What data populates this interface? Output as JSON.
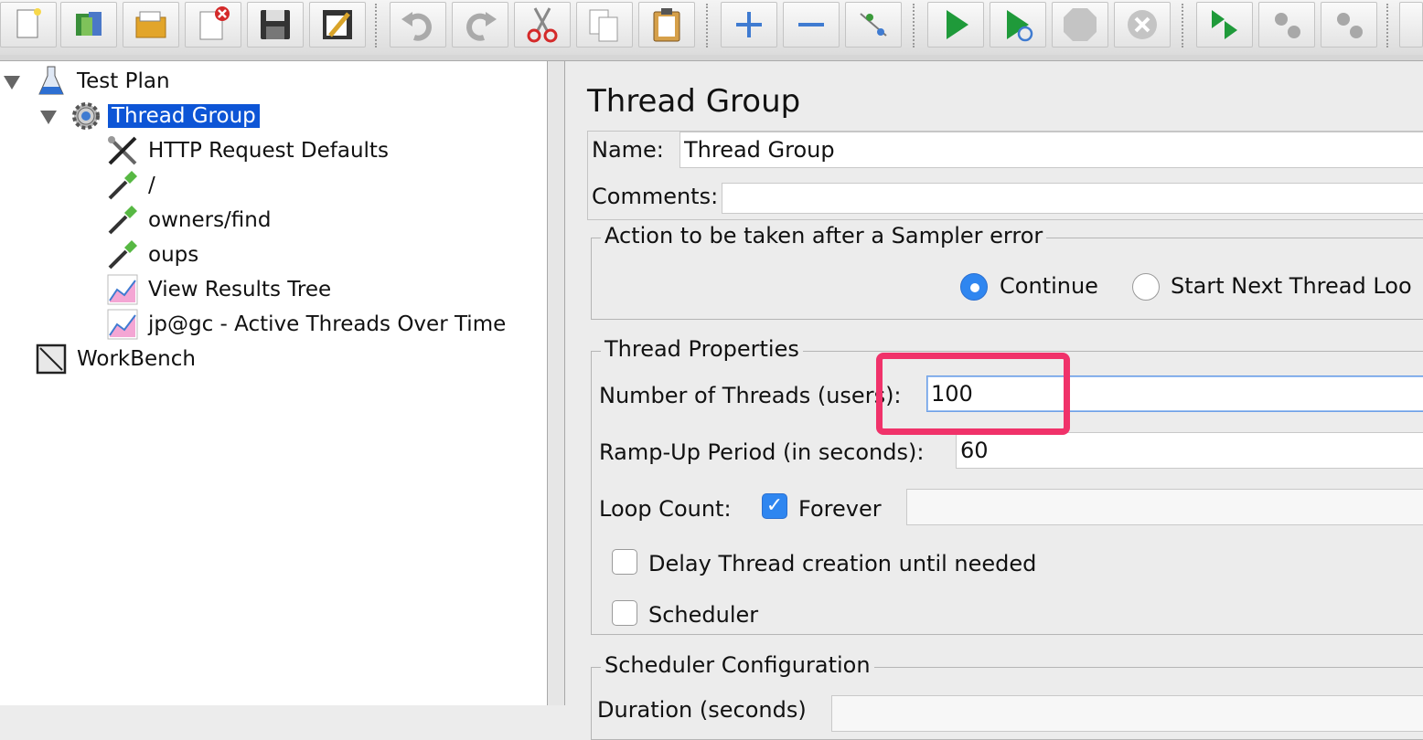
{
  "toolbar": {
    "buttons": [
      {
        "icon": "new-template-icon"
      },
      {
        "icon": "templates-icon"
      },
      {
        "icon": "open-icon"
      },
      {
        "icon": "close-icon"
      },
      {
        "icon": "save-icon"
      },
      {
        "icon": "save-as-icon"
      },
      {
        "icon": "undo-icon"
      },
      {
        "icon": "redo-icon"
      },
      {
        "icon": "cut-icon"
      },
      {
        "icon": "copy-icon"
      },
      {
        "icon": "paste-icon"
      },
      {
        "icon": "expand-all-icon"
      },
      {
        "icon": "collapse-all-icon"
      },
      {
        "icon": "toggle-icon"
      },
      {
        "icon": "start-icon"
      },
      {
        "icon": "start-no-timers-icon"
      },
      {
        "icon": "stop-icon"
      },
      {
        "icon": "shutdown-icon"
      },
      {
        "icon": "remote-start-all-icon"
      },
      {
        "icon": "remote-stop-all-icon"
      },
      {
        "icon": "remote-shutdown-all-icon"
      }
    ]
  },
  "tree": {
    "items": [
      {
        "label": "Test Plan"
      },
      {
        "label": "Thread Group",
        "selected": true
      },
      {
        "label": "HTTP Request Defaults"
      },
      {
        "label": "/"
      },
      {
        "label": "owners/find"
      },
      {
        "label": "oups"
      },
      {
        "label": "View Results Tree"
      },
      {
        "label": "jp@gc - Active Threads Over Time"
      },
      {
        "label": "WorkBench"
      }
    ]
  },
  "main": {
    "title": "Thread Group",
    "name_label": "Name:",
    "name_value": "Thread Group",
    "comments_label": "Comments:",
    "comments_value": "",
    "error_action": {
      "legend": "Action to be taken after a Sampler error",
      "options": [
        {
          "label": "Continue",
          "selected": true
        },
        {
          "label": "Start Next Thread Loo",
          "selected": false
        }
      ]
    },
    "thread_properties": {
      "legend": "Thread Properties",
      "threads_label": "Number of Threads (users):",
      "threads_value": "100",
      "rampup_label": "Ramp-Up Period (in seconds):",
      "rampup_value": "60",
      "loop_label": "Loop Count:",
      "forever_label": "Forever",
      "forever_checked": true,
      "loop_value": "",
      "delay_label": "Delay Thread creation until needed",
      "delay_checked": false,
      "scheduler_label": "Scheduler",
      "scheduler_checked": false
    },
    "scheduler_config": {
      "legend": "Scheduler Configuration",
      "duration_label": "Duration (seconds)"
    }
  },
  "colors": {
    "selection": "#0d55d6",
    "highlight": "#f0326a",
    "accent": "#2f86f0"
  }
}
